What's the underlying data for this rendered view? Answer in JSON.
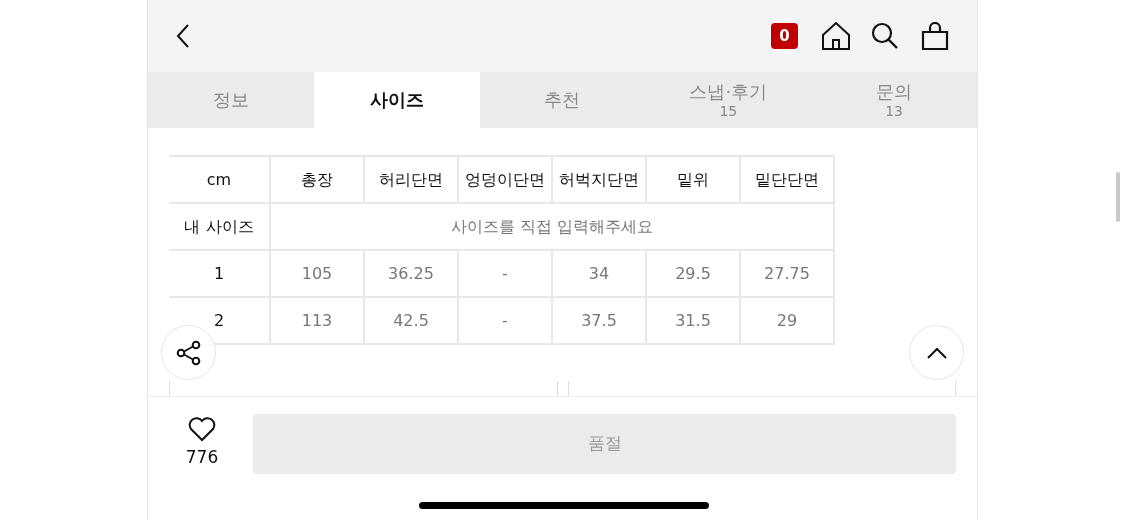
{
  "header": {
    "cart_count": "0"
  },
  "tabs": [
    {
      "label": "정보",
      "selected": false
    },
    {
      "label": "사이즈",
      "selected": true
    },
    {
      "label": "추천",
      "selected": false
    },
    {
      "label": "스냅·후기",
      "count": "15",
      "selected": false
    },
    {
      "label": "문의",
      "count": "13",
      "selected": false
    }
  ],
  "size_table": {
    "columns": [
      "cm",
      "총장",
      "허리단면",
      "엉덩이단면",
      "허벅지단면",
      "밑위",
      "밑단단면"
    ],
    "my_size": {
      "label": "내 사이즈",
      "prompt": "사이즈를 직접 입력해주세요"
    },
    "rows": [
      [
        "1",
        "105",
        "36.25",
        "-",
        "34",
        "29.5",
        "27.75"
      ],
      [
        "2",
        "113",
        "42.5",
        "-",
        "37.5",
        "31.5",
        "29"
      ]
    ]
  },
  "bottom_bar": {
    "like_count": "776",
    "buy_button": {
      "label": "품절",
      "disabled": true
    }
  }
}
